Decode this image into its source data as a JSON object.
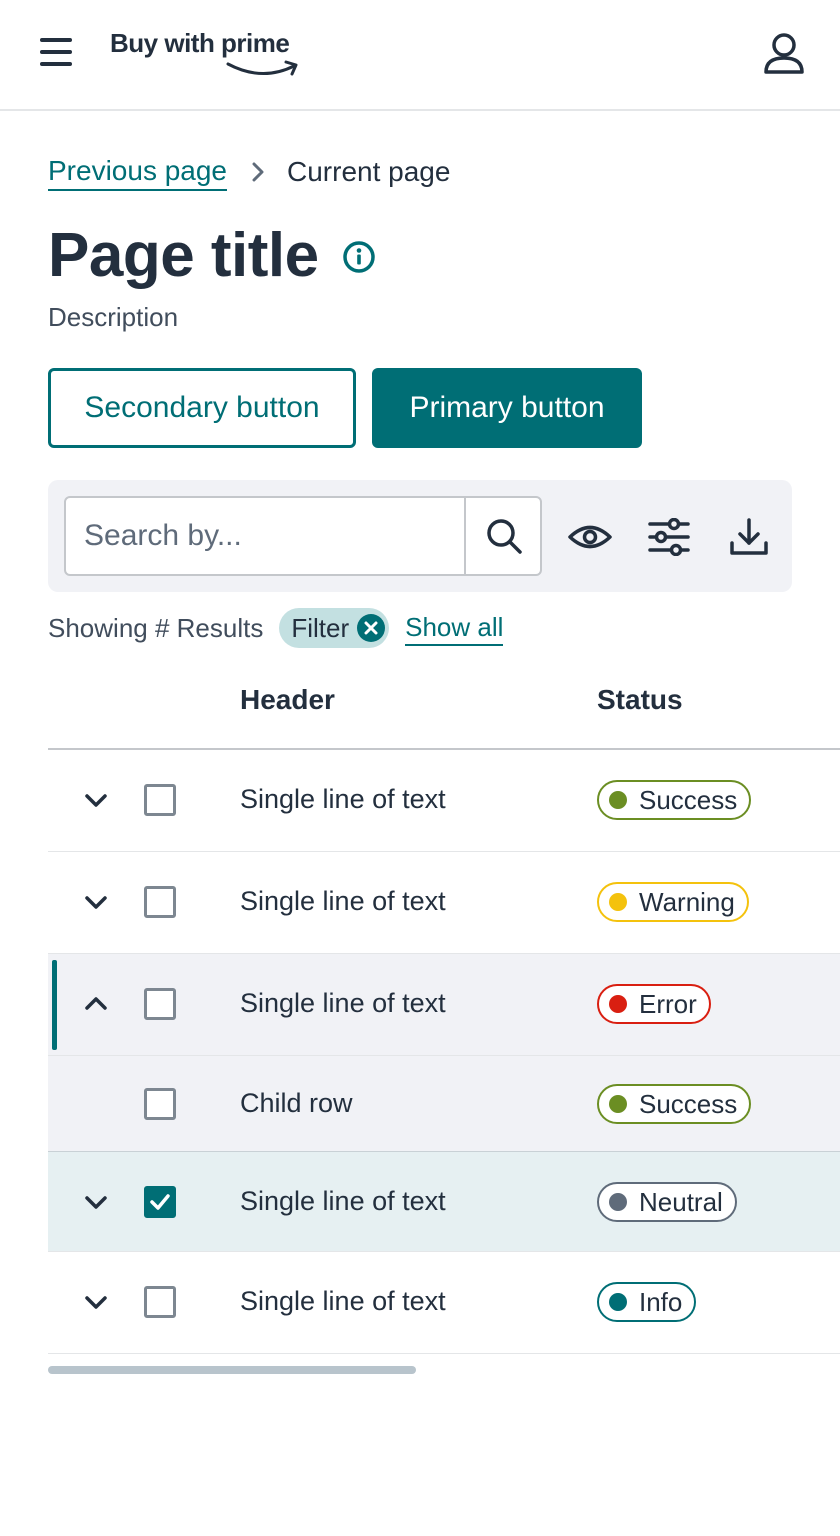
{
  "header": {
    "logo_text": "Buy with prime",
    "menu_icon": "hamburger-menu-icon",
    "account_icon": "user-account-icon"
  },
  "breadcrumb": {
    "previous": "Previous page",
    "current": "Current page"
  },
  "page": {
    "title": "Page title",
    "description": "Description"
  },
  "actions": {
    "secondary_label": "Secondary button",
    "primary_label": "Primary button"
  },
  "toolbar": {
    "search_placeholder": "Search by...",
    "icons": [
      "search-icon",
      "eye-icon",
      "sliders-icon",
      "download-icon"
    ]
  },
  "results": {
    "text": "Showing # Results",
    "filter_label": "Filter",
    "show_all": "Show all"
  },
  "table": {
    "headers": [
      "Header",
      "Status"
    ],
    "rows": [
      {
        "text": "Single line of text",
        "status": "Success",
        "expanded": false,
        "checked": false
      },
      {
        "text": "Single line of text",
        "status": "Warning",
        "expanded": false,
        "checked": false
      },
      {
        "text": "Single line of text",
        "status": "Error",
        "expanded": true,
        "checked": false
      },
      {
        "text": "Child row",
        "status": "Success",
        "child": true,
        "checked": false
      },
      {
        "text": "Single line of text",
        "status": "Neutral",
        "expanded": false,
        "checked": true
      },
      {
        "text": "Single line of text",
        "status": "Info",
        "expanded": false,
        "checked": false
      }
    ]
  },
  "colors": {
    "brand": "#006e75",
    "text": "#232f3e",
    "success": "#6b8e23",
    "warning": "#f4c20d",
    "error": "#d91f11",
    "neutral": "#5f6b7a",
    "info": "#006e75"
  }
}
